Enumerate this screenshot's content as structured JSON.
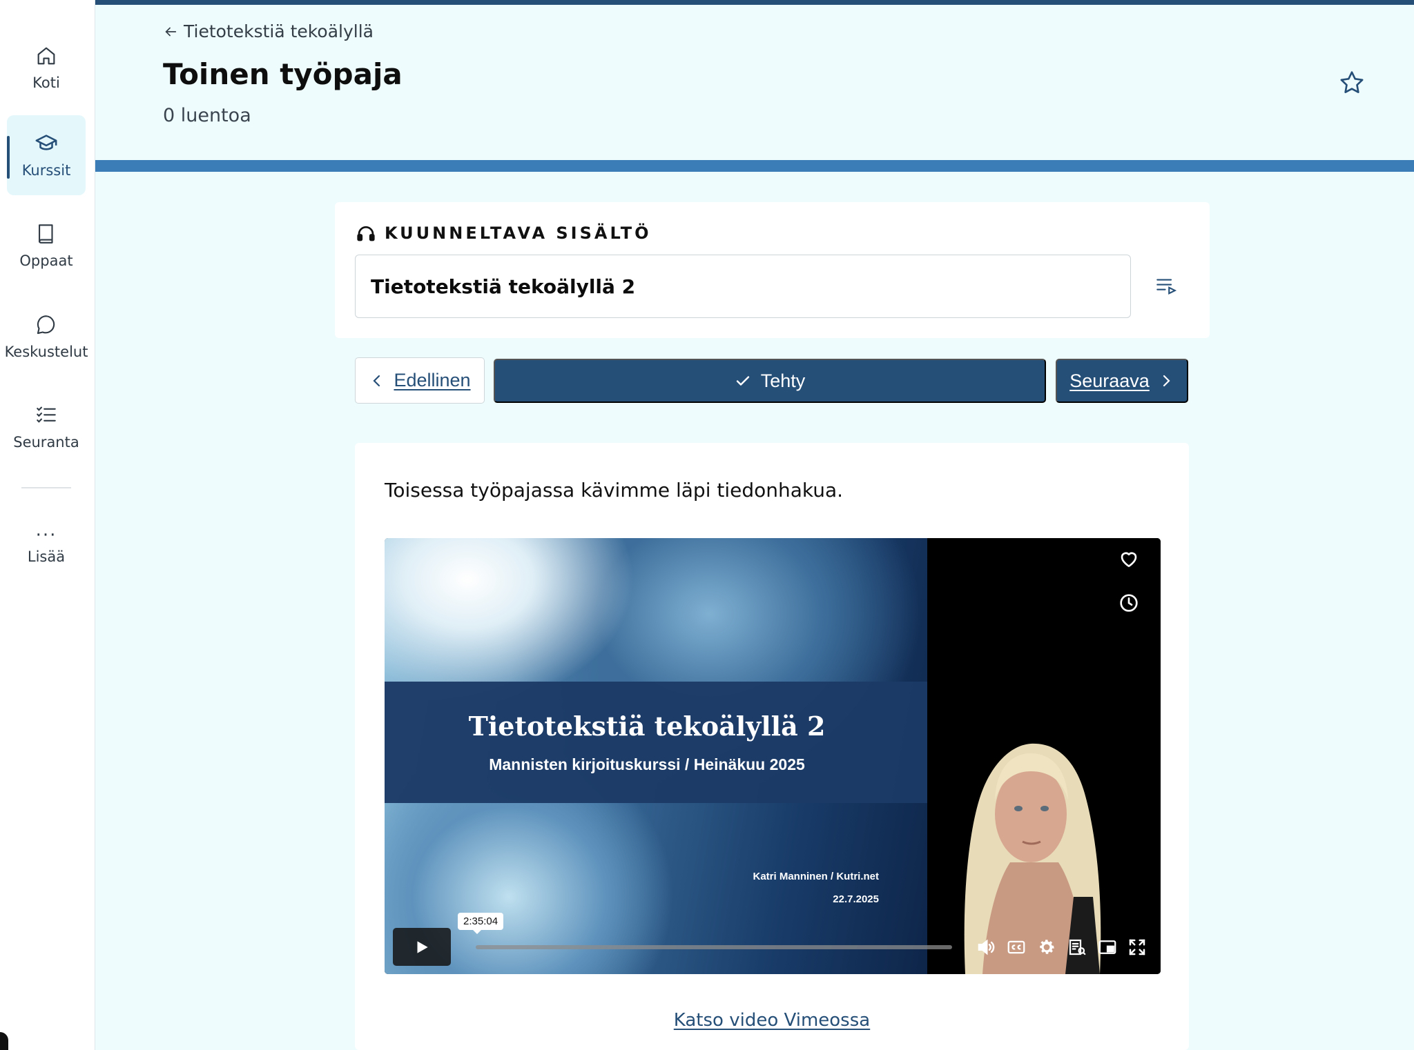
{
  "sidebar": {
    "items": [
      {
        "label": "Koti",
        "icon": "home-icon"
      },
      {
        "label": "Kurssit",
        "icon": "graduation-cap-icon",
        "active": true
      },
      {
        "label": "Oppaat",
        "icon": "book-icon"
      },
      {
        "label": "Keskustelut",
        "icon": "chat-bubble-icon"
      },
      {
        "label": "Seuranta",
        "icon": "checklist-icon"
      }
    ],
    "more": {
      "label": "Lisää",
      "icon": "more-dots-icon",
      "glyph": "···"
    }
  },
  "header": {
    "breadcrumb": "Tietotekstiä tekoälyllä",
    "title": "Toinen työpaja",
    "lecture_count": "0 luentoa"
  },
  "audio": {
    "heading": "KUUNNELTAVA SISÄLTÖ",
    "selected": "Tietotekstiä tekoälyllä 2"
  },
  "navigation": {
    "previous_label": "Edellinen",
    "done_label": "Tehty",
    "next_label": "Seuraava"
  },
  "content": {
    "intro": "Toisessa työpajassa kävimme läpi tiedonhakua.",
    "video": {
      "slide_title": "Tietotekstiä tekoälyllä 2",
      "slide_subtitle": "Mannisten kirjoituskurssi / Heinäkuu 2025",
      "slide_author": "Katri Manninen / Kutri.net",
      "slide_date": "22.7.2025",
      "duration_tooltip": "2:35:04",
      "progress_fraction": 0.0
    },
    "vimeo_link": "Katso video Vimeossa"
  },
  "colors": {
    "primary": "#264f78",
    "band": "#3b7db7",
    "page_bg": "#eefcfd"
  }
}
